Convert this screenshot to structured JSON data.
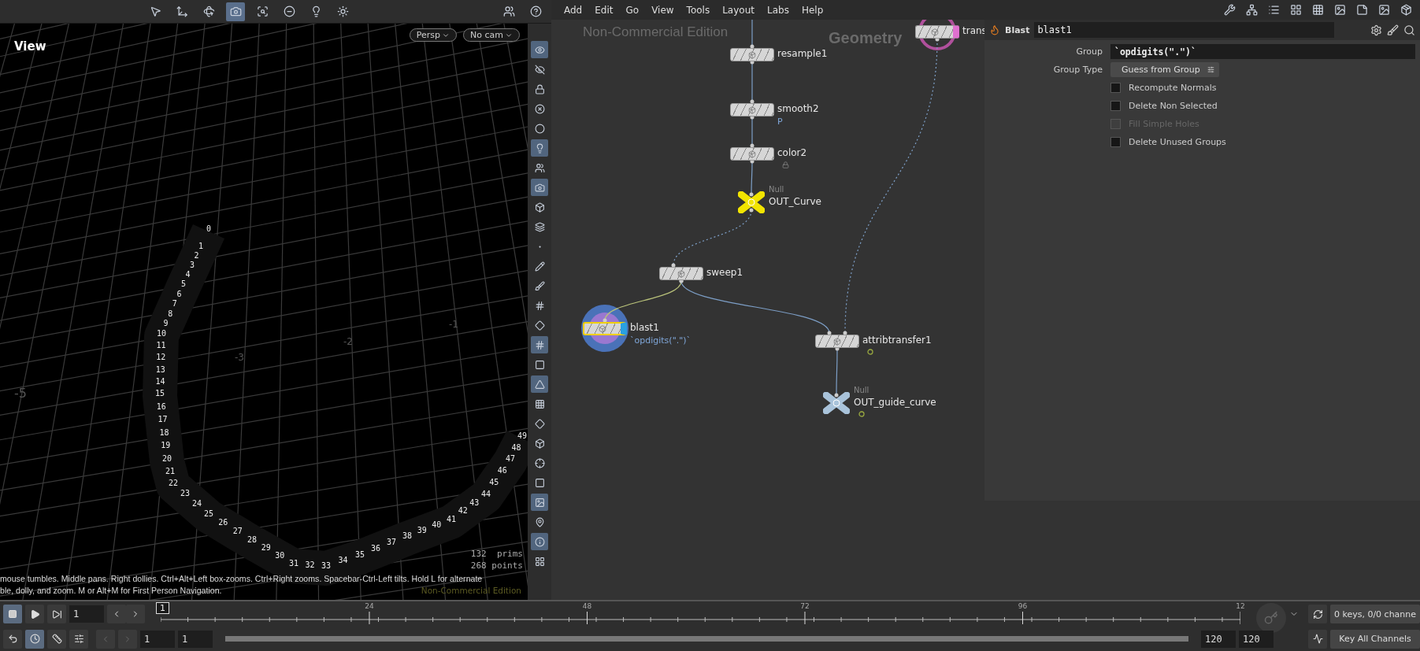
{
  "viewport": {
    "toolbar": [
      {
        "selected": false
      },
      {
        "selected": false
      },
      {
        "selected": false
      },
      {
        "selected": true
      },
      {
        "selected": false
      },
      {
        "selected": false
      },
      {
        "selected": false
      },
      {
        "selected": false
      }
    ],
    "toolbar_right": [
      {
        "selected": false
      },
      {
        "selected": false
      }
    ],
    "title": "View",
    "camera_buttons": [
      "Persp",
      "No cam"
    ],
    "axis_labels": [
      "-5",
      "-3",
      "-2",
      "-1"
    ],
    "point_numbers": [
      "0",
      "1",
      "2",
      "3",
      "4",
      "5",
      "6",
      "7",
      "8",
      "9",
      "10",
      "11",
      "12",
      "13",
      "14",
      "15",
      "16",
      "17",
      "18",
      "19",
      "20",
      "21",
      "22",
      "23",
      "24",
      "25",
      "26",
      "27",
      "28",
      "29",
      "30",
      "31",
      "32",
      "33",
      "34",
      "35",
      "36",
      "37",
      "38",
      "39",
      "40",
      "41",
      "42",
      "43",
      "44",
      "45",
      "46",
      "47",
      "48",
      "49"
    ],
    "stats": [
      "132  prims",
      "268 points"
    ],
    "hint": [
      "mouse tumbles. Middle pans. Right dollies. Ctrl+Alt+Left box-zooms. Ctrl+Right zooms. Spacebar-Ctrl-Left tilts. Hold L for alternate",
      "ble, dolly, and zoom. M or Alt+M for First Person Navigation."
    ],
    "watermark": "Non-Commercial Edition"
  },
  "side_toolbar": [
    {
      "selected": true
    },
    {
      "selected": false
    },
    {
      "selected": false
    },
    {
      "selected": false
    },
    {
      "selected": false
    },
    {
      "selected": true
    },
    {
      "selected": false
    },
    {
      "selected": true
    },
    {
      "selected": false
    },
    {
      "selected": false
    },
    {
      "selected": false
    },
    {
      "selected": false
    },
    {
      "selected": false
    },
    {
      "selected": false
    },
    {
      "selected": false
    },
    {
      "selected": true
    },
    {
      "selected": false
    },
    {
      "selected": true
    },
    {
      "selected": false
    },
    {
      "selected": false
    },
    {
      "selected": false
    },
    {
      "selected": false
    },
    {
      "selected": false
    },
    {
      "selected": true
    },
    {
      "selected": false
    },
    {
      "selected": true
    },
    {
      "selected": false
    }
  ],
  "network": {
    "menu": [
      "Add",
      "Edit",
      "Go",
      "View",
      "Tools",
      "Layout",
      "Labs",
      "Help"
    ],
    "watermarks": [
      "Non-Commercial Edition",
      "Geometry"
    ],
    "nodes": [
      {
        "name": "trans",
        "kind": "sop",
        "selected": false,
        "display": true,
        "badge": false,
        "locked": false
      },
      {
        "name": "resample1",
        "kind": "sop",
        "selected": false,
        "display": false,
        "badge": false,
        "locked": false
      },
      {
        "name": "smooth2",
        "kind": "sop",
        "sublabel": "P",
        "selected": false,
        "display": false,
        "badge": false,
        "locked": false
      },
      {
        "name": "color2",
        "kind": "sop",
        "selected": false,
        "display": false,
        "badge": false,
        "locked": true
      },
      {
        "name": "OUT_Curve",
        "kind": "null",
        "type_label": "Null",
        "color": "#f2e400",
        "selected": false,
        "display": false,
        "badge": false,
        "locked": false
      },
      {
        "name": "sweep1",
        "kind": "sop",
        "selected": false,
        "display": false,
        "badge": false,
        "locked": false
      },
      {
        "name": "blast1",
        "kind": "sop",
        "sublabel": "`opdigits(\".\")`",
        "selected": true,
        "display": true,
        "badge": false,
        "locked": false
      },
      {
        "name": "attribtransfer1",
        "kind": "sop",
        "selected": false,
        "display": false,
        "badge": true,
        "locked": false
      },
      {
        "name": "OUT_guide_curve",
        "kind": "null",
        "type_label": "Null",
        "color": "#a9c3da",
        "selected": false,
        "display": false,
        "badge": true,
        "locked": false
      }
    ]
  },
  "menu_icons": [
    {
      "selected": false
    },
    {
      "selected": false
    },
    {
      "selected": false
    },
    {
      "selected": false
    },
    {
      "selected": false
    },
    {
      "selected": false
    },
    {
      "selected": false
    },
    {
      "selected": false
    },
    {
      "selected": false
    }
  ],
  "parameters": {
    "type_label": "Blast",
    "node_name": "blast1",
    "fields": [
      {
        "kind": "text",
        "label": "Group",
        "value": "`opdigits(\".\")`"
      },
      {
        "kind": "menu",
        "label": "Group Type",
        "value": "Guess from Group"
      },
      {
        "kind": "checkbox",
        "label": "Recompute Normals",
        "checked": false,
        "disabled": false
      },
      {
        "kind": "checkbox",
        "label": "Delete Non Selected",
        "checked": false,
        "disabled": false
      },
      {
        "kind": "checkbox",
        "label": "Fill Simple Holes",
        "checked": false,
        "disabled": true
      },
      {
        "kind": "checkbox",
        "label": "Delete Unused Groups",
        "checked": false,
        "disabled": false
      }
    ]
  },
  "timeline": {
    "frame": "1",
    "marker": "1",
    "ticks": [
      "24",
      "48",
      "72",
      "96",
      "12"
    ],
    "range": [
      "1",
      "1",
      "120",
      "120"
    ],
    "range_slider": {
      "level": 1
    },
    "keys_status": "0 keys, 0/0 channe",
    "key_all": "Key All Channels"
  }
}
